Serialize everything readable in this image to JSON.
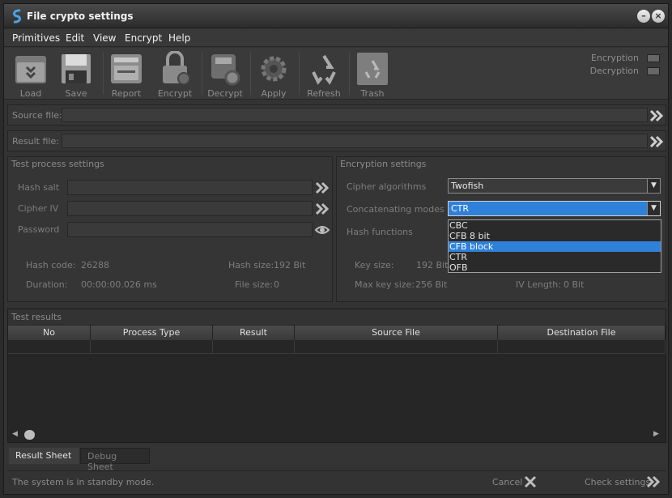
{
  "window": {
    "title": "File crypto settings"
  },
  "menu": [
    "Primitives",
    "Edit",
    "View",
    "Encrypt",
    "Help"
  ],
  "toolbar": {
    "load": "Load",
    "save": "Save",
    "report": "Report",
    "encrypt": "Encrypt",
    "decrypt": "Decrypt",
    "apply": "Apply",
    "refresh": "Refresh",
    "trash": "Trash"
  },
  "switches": {
    "encryption": "Encryption",
    "decryption": "Decryption"
  },
  "files": {
    "source_label": "Source file:",
    "source_value": "",
    "result_label": "Result file:",
    "result_value": ""
  },
  "test_process": {
    "title": "Test process settings",
    "hash_salt": "Hash salt",
    "cipher_iv": "Cipher IV",
    "password": "Password",
    "hash_code_label": "Hash code:",
    "hash_code": "26288",
    "hash_size_label": "Hash size:",
    "hash_size": "192 Bit",
    "duration_label": "Duration:",
    "duration": "00:00:00.026 ms",
    "file_size_label": "File size:",
    "file_size": "0"
  },
  "encryption": {
    "title": "Encryption settings",
    "cipher_label": "Cipher algorithms",
    "cipher_value": "Twofish",
    "modes_label": "Concatenating modes",
    "modes_value": "CTR",
    "hash_label": "Hash functions",
    "key_size_label": "Key size:",
    "key_size": "192 Bit",
    "max_key_label": "Max key size:",
    "max_key": "256 Bit",
    "iv_label": "IV Length:",
    "iv_length": "0 Bit",
    "mode_options": [
      "CBC",
      "CFB 8 bit",
      "CFB block",
      "CTR",
      "OFB"
    ]
  },
  "results": {
    "title": "Test results",
    "columns": [
      "No",
      "Process Type",
      "Result",
      "Source File",
      "Destination File"
    ]
  },
  "tabs": {
    "result": "Result Sheet",
    "debug": "Debug Sheet"
  },
  "status": {
    "text": "The system is in standby mode.",
    "cancel": "Cancel",
    "check": "Check settings"
  },
  "colors": {
    "accent": "#2f80d8",
    "background": "#333333"
  }
}
